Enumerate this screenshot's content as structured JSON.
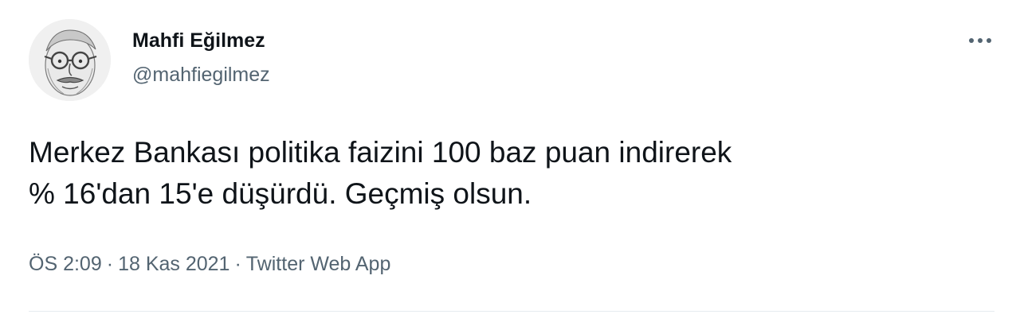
{
  "user": {
    "display_name": "Mahfi Eğilmez",
    "handle": "@mahfiegilmez",
    "avatar": "avatar-portrait-sketch"
  },
  "header": {
    "more_icon": "more-horizontal-icon"
  },
  "tweet": {
    "text": "Merkez Bankası politika faizini 100 baz puan indirerek\n% 16'dan 15'e düşürdü. Geçmiş olsun."
  },
  "meta": {
    "time": "ÖS 2:09",
    "date": "18 Kas 2021",
    "source": "Twitter Web App",
    "separator": "·"
  },
  "colors": {
    "text_primary": "#0f1419",
    "text_secondary": "#536471",
    "divider": "#e6ecf0"
  }
}
